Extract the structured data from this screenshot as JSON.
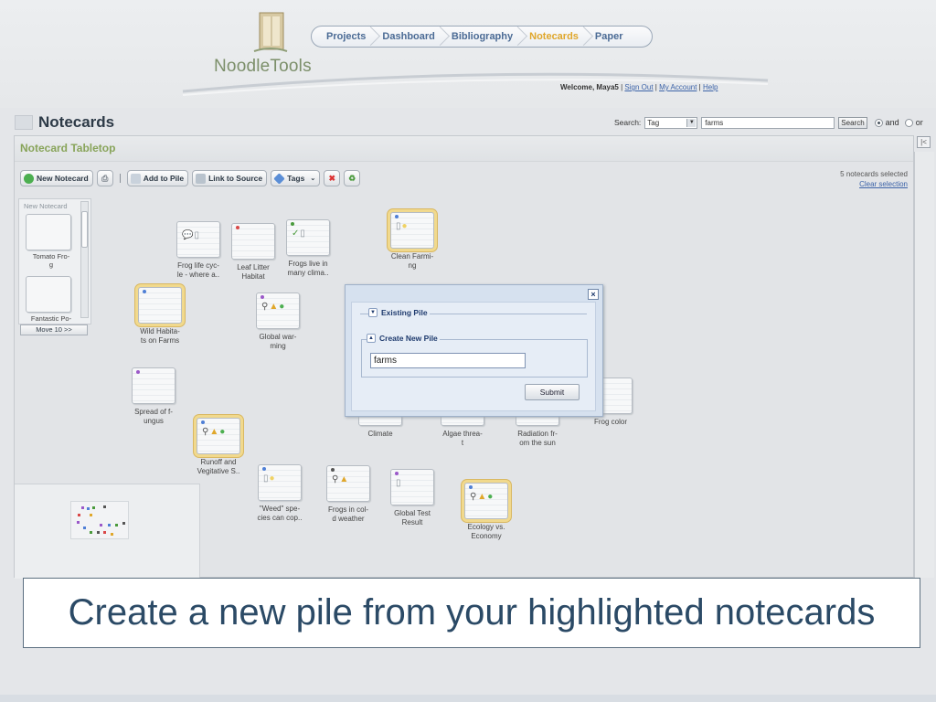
{
  "app": {
    "logo_text": "NoodleTools",
    "nav": [
      "Projects",
      "Dashboard",
      "Bibliography",
      "Notecards",
      "Paper"
    ],
    "nav_active": "Notecards",
    "welcome": {
      "prefix": "Welcome, Maya5",
      "links": [
        "Sign Out",
        "My Account",
        "Help"
      ]
    }
  },
  "page": {
    "title": "Notecards"
  },
  "search": {
    "label": "Search:",
    "type_value": "Tag",
    "query": "farms",
    "button": "Search",
    "radio_and": "and",
    "radio_or": "or",
    "selected": "and"
  },
  "tabletop": {
    "title": "Notecard Tabletop",
    "collapse_label": "|<",
    "toolbar": {
      "new_notecard": "New Notecard",
      "add_to_pile": "Add to Pile",
      "link_to_source": "Link to Source",
      "tags": "Tags"
    },
    "selection": {
      "count_text": "5 notecards selected",
      "clear": "Clear selection"
    },
    "pile_column": {
      "header": "New Notecard",
      "items": [
        "Tomato Fro-\ng",
        "Fantastic Po-"
      ],
      "move_button": "Move 10 >>"
    },
    "cards": [
      {
        "label": "Frog life cyc-\nle - where a..",
        "selected": false,
        "dot": "",
        "icons": [
          "speech-icon",
          "page-icon"
        ]
      },
      {
        "label": "Leaf Litter\nHabitat",
        "selected": false,
        "dot": "#d94848",
        "icons": []
      },
      {
        "label": "Frogs live in\nmany clima..",
        "selected": false,
        "dot": "#4a9a3c",
        "icons": [
          "check-icon",
          "page-icon"
        ]
      },
      {
        "label": "Clean Farmi-\nng",
        "selected": true,
        "dot": "#4f7fd6",
        "icons": [
          "page-icon",
          "bulb-icon"
        ]
      },
      {
        "label": "Wild Habita-\nts on Farms",
        "selected": true,
        "dot": "#4f7fd6",
        "icons": []
      },
      {
        "label": "Global war-\nming",
        "selected": false,
        "dot": "#9b59c9",
        "icons": [
          "magnifier-icon",
          "warning-icon",
          "ok-icon"
        ]
      },
      {
        "label": "Spread of f-\nungus",
        "selected": false,
        "dot": "#9b59c9",
        "icons": []
      },
      {
        "label": "Runoff and\nVegitative S..",
        "selected": true,
        "dot": "#4f7fd6",
        "icons": [
          "magnifier-icon",
          "warning-icon",
          "ok-icon"
        ]
      },
      {
        "label": "\"Weed\" spe-\ncies can cop..",
        "selected": false,
        "dot": "#4f7fd6",
        "icons": [
          "page-icon",
          "bulb-icon"
        ]
      },
      {
        "label": "Frogs in col-\nd weather",
        "selected": false,
        "dot": "#555555",
        "icons": [
          "magnifier-icon",
          "warning-icon"
        ]
      },
      {
        "label": "Global Test\nResult",
        "selected": false,
        "dot": "#9b59c9",
        "icons": [
          "page-icon"
        ]
      },
      {
        "label": "Ecology vs.\nEconomy",
        "selected": true,
        "dot": "#4f7fd6",
        "icons": [
          "magnifier-icon",
          "warning-icon",
          "ok-icon"
        ]
      },
      {
        "label": "Climate",
        "selected": false,
        "dot": "",
        "icons": []
      },
      {
        "label": "Algae threa-\nt",
        "selected": false,
        "dot": "",
        "icons": []
      },
      {
        "label": "Radiation fr-\nom the sun",
        "selected": false,
        "dot": "",
        "icons": []
      },
      {
        "label": "Frog color",
        "selected": false,
        "dot": "",
        "icons": []
      }
    ]
  },
  "dialog": {
    "existing_pile": "Existing Pile",
    "create_new_pile": "Create New Pile",
    "input_value": "farms",
    "submit": "Submit",
    "close": "×"
  },
  "caption": "Create a new pile from your highlighted notecards",
  "colors": {
    "accent_orange": "#e0a72b",
    "tabletop_title_green": "#88a45a",
    "link_blue": "#3c63a8",
    "dialog_blue": "#d6e1ef",
    "selected_glow": "#f1d98d"
  }
}
